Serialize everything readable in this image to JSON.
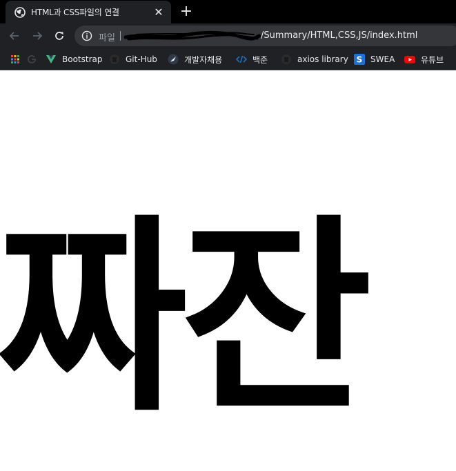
{
  "browser": {
    "tab": {
      "title": "HTML과 CSS파일의 연결",
      "close": "✕"
    },
    "new_tab": "+",
    "address": {
      "scheme_label": "파일",
      "url_path": "/Summary/HTML,CSS,JS/index.html"
    },
    "bookmarks": [
      {
        "label": "",
        "icon": "apps-icon"
      },
      {
        "label": "",
        "icon": "google-icon"
      },
      {
        "label": "Bootstrap",
        "icon": "vue-icon"
      },
      {
        "label": "Git-Hub",
        "icon": "github-icon"
      },
      {
        "label": "개발자채용",
        "icon": "rocket-icon"
      },
      {
        "label": "백준",
        "icon": "code-icon"
      },
      {
        "label": "axios library",
        "icon": "github-icon"
      },
      {
        "label": "SWEA",
        "icon": "swea-icon"
      },
      {
        "label": "유튜브",
        "icon": "youtube-icon"
      }
    ]
  },
  "page": {
    "headline": "짜잔"
  },
  "colors": {
    "tab_bg": "#202124",
    "frame_bg": "#000000",
    "omnibox_bg": "#35363a",
    "text": "#e8eaed",
    "muted": "#9aa0a6",
    "youtube_red": "#ff0000",
    "swea_blue": "#1e6fd9"
  }
}
